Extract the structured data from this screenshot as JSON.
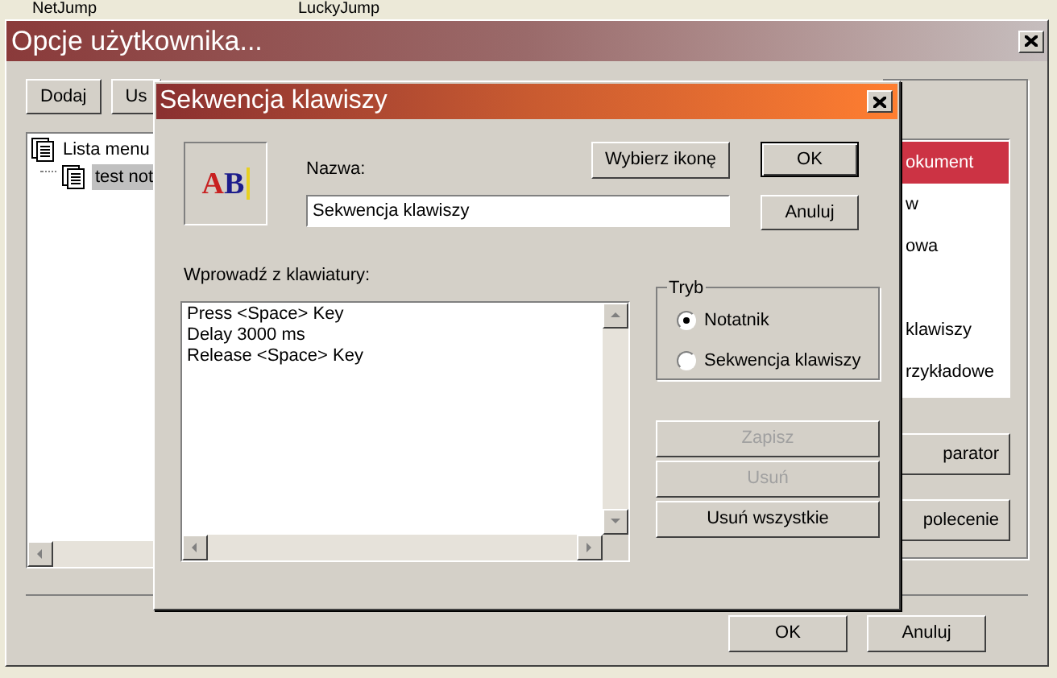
{
  "background_window": {
    "columns": [
      "NetJump",
      "LuckyJump"
    ]
  },
  "window": {
    "title": "Opcje użytkownika...",
    "toolbar": [
      "Dodaj",
      "Us"
    ],
    "tree": [
      {
        "label": "Lista menu",
        "selected": false,
        "children": [
          {
            "label": "test not",
            "selected": true
          }
        ]
      }
    ],
    "list": [
      {
        "label": "okument",
        "selected": true
      },
      {
        "label": "w",
        "selected": false
      },
      {
        "label": "owa",
        "selected": false
      },
      {
        "label": "klawiszy",
        "selected": false
      },
      {
        "label": "rzykładowe",
        "selected": false
      }
    ],
    "side_buttons": [
      "parator",
      "polecenie"
    ],
    "buttons": [
      "OK",
      "Anuluj"
    ]
  },
  "dialog": {
    "title": "Sekwencja klawiszy",
    "icon_letters": [
      {
        "text": "A",
        "color": "#c82020"
      },
      {
        "text": "B",
        "color": "#1c1c8c"
      }
    ],
    "name_label": "Nazwa:",
    "name_value": "Sekwencja klawiszy",
    "choose_icon_button": "Wybierz ikonę",
    "ok_button": "OK",
    "cancel_button": "Anuluj",
    "input_label": "Wprowadź z klawiatury:",
    "sequence": [
      "Press <Space> Key",
      "Delay 3000 ms",
      "Release <Space> Key"
    ],
    "mode": {
      "title": "Tryb",
      "options": [
        {
          "label": "Notatnik",
          "selected": true
        },
        {
          "label": "Sekwencja klawiszy",
          "selected": false
        }
      ]
    },
    "actions": [
      {
        "label": "Zapisz",
        "disabled": true
      },
      {
        "label": "Usuń",
        "disabled": true
      },
      {
        "label": "Usuń wszystkie",
        "disabled": false
      }
    ]
  }
}
